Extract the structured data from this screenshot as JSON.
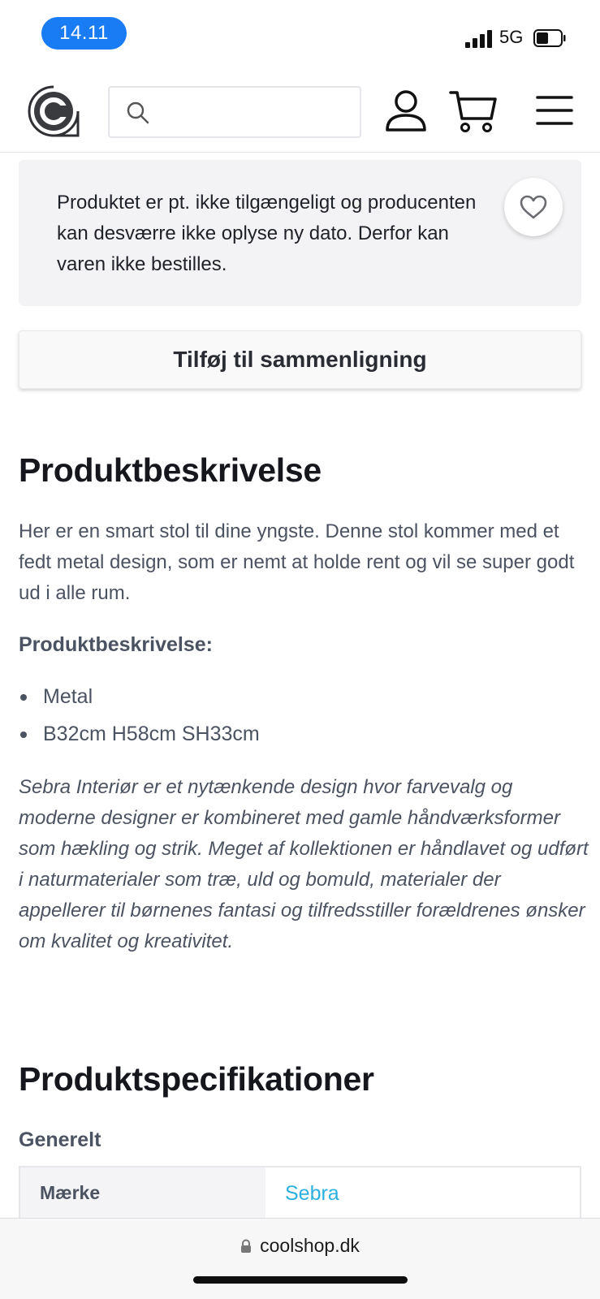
{
  "status_bar": {
    "time": "14.11",
    "network": "5G"
  },
  "header": {
    "logo_icon": "coolshop-logo-icon",
    "search": {
      "value": "",
      "placeholder": "",
      "icon": "search-icon"
    },
    "account_icon": "account-icon",
    "cart_icon": "cart-icon",
    "menu_icon": "hamburger-menu-icon"
  },
  "notice": {
    "text": "Produktet er pt. ikke tilgængeligt og producenten kan desværre ikke oplyse ny dato. Derfor kan varen ikke bestilles.",
    "wishlist_icon": "heart-icon"
  },
  "compare_button": {
    "label": "Tilføj til sammenligning"
  },
  "description": {
    "title": "Produktbeskrivelse",
    "text": "Her er en smart stol til dine yngste. Denne stol kommer med et fedt metal design, som er nemt at holde rent og vil se super godt ud i alle rum.",
    "subtitle": "Produktbeskrivelse:",
    "bullets": [
      "Metal",
      "B32cm H58cm SH33cm"
    ],
    "italic_text": "Sebra Interiør er et nytænkende design hvor farvevalg og moderne designer er kombineret med gamle håndværksformer som hækling og strik. Meget af kollektionen er håndlavet og udført i naturmaterialer som træ, uld og bomuld, materialer der appellerer til børnenes fantasi og tilfredsstiller forældrenes ønsker om kvalitet og kreativitet."
  },
  "specifications": {
    "title": "Produktspecifikationer",
    "group": "Generelt",
    "rows": [
      {
        "key": "Mærke",
        "value": "Sebra"
      }
    ]
  },
  "browser": {
    "url": "coolshop.dk",
    "lock_icon": "lock-icon"
  },
  "colors": {
    "time_pill": "#1a7cf5",
    "link": "#2bb0e0",
    "text_muted": "#4b5261",
    "notice_bg": "#f3f3f5"
  }
}
